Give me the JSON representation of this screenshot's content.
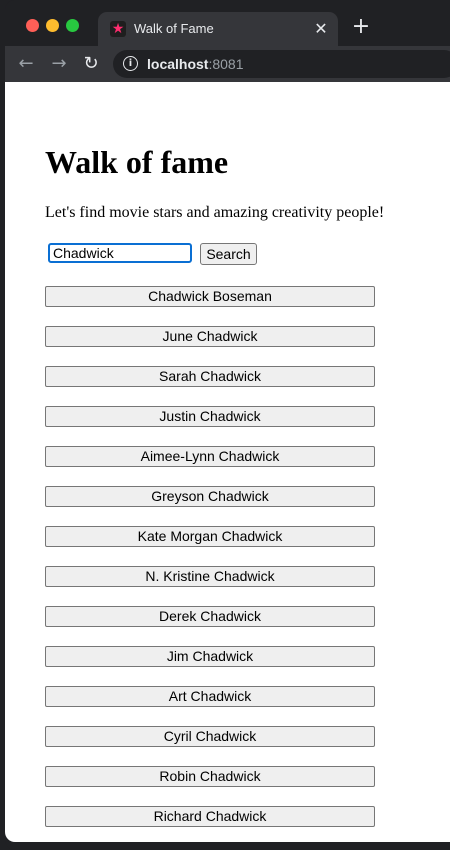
{
  "browser": {
    "tab_title": "Walk of Fame",
    "favicon_glyph": "★",
    "close_glyph": "✕",
    "new_tab_glyph": "+",
    "url_host": "localhost",
    "url_port": ":8081",
    "icons": {
      "back": "arrow-left-icon",
      "forward": "arrow-right-icon",
      "reload": "reload-icon",
      "info": "info-icon"
    }
  },
  "page": {
    "title": "Walk of fame",
    "subtitle": "Let's find movie stars and amazing creativity people!",
    "search": {
      "value": "Chadwick",
      "button_label": "Search"
    },
    "results": [
      "Chadwick Boseman",
      "June Chadwick",
      "Sarah Chadwick",
      "Justin Chadwick",
      "Aimee-Lynn Chadwick",
      "Greyson Chadwick",
      "Kate Morgan Chadwick",
      "N. Kristine Chadwick",
      "Derek Chadwick",
      "Jim Chadwick",
      "Art Chadwick",
      "Cyril Chadwick",
      "Robin Chadwick",
      "Richard Chadwick"
    ]
  },
  "colors": {
    "focus_ring": "#0a6fd3",
    "favicon": "#ff2d6f",
    "browser_chrome": "#35363a"
  }
}
